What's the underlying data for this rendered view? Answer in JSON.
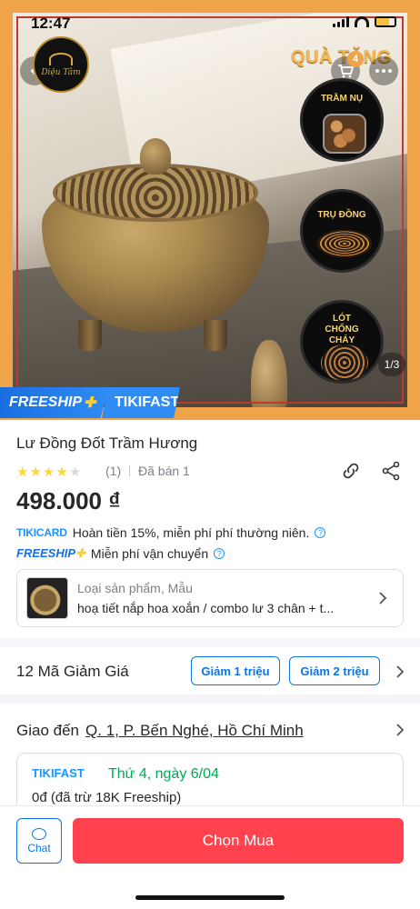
{
  "status": {
    "time": "12:47"
  },
  "hero": {
    "logo_text": "Diệu Tâm",
    "gift_title": "QUÀ TẶNG",
    "cart_count": "4",
    "gifts": [
      "TRẦM NỤ",
      "TRỤ ĐỒNG",
      "LÓT CHỐNG CHÁY"
    ],
    "image_counter": "1/3",
    "freeship_label": "FREESHIP",
    "tikifast_label": "TIKIFAST"
  },
  "product": {
    "title": "Lư Đồng Đốt Trầm Hương",
    "rating": 4,
    "rating_count": "(1)",
    "sold": "Đã bán 1",
    "price": "498.000 ₫"
  },
  "promos": [
    {
      "logo": "TIKICARD",
      "text": "Hoàn tiền 15%, miễn phí phí thường niên."
    },
    {
      "logo": "FREESHIP",
      "text": "Miễn phí vận chuyển"
    }
  ],
  "variant": {
    "label": "Loại sản phẩm, Mẫu",
    "value": "hoạ tiết nắp hoa xoắn / combo lư 3 chân + t..."
  },
  "coupons": {
    "title": "12 Mã Giảm Giá",
    "tags": [
      "Giảm 1 triệu",
      "Giảm 2 triệu"
    ]
  },
  "delivery": {
    "prefix": "Giao đến",
    "address": "Q. 1, P. Bến Nghé, Hồ Chí Minh",
    "service": "TIKIFAST",
    "date": "Thứ 4, ngày 6/04",
    "fee": "0đ (đã trừ 18K Freeship)"
  },
  "bottom": {
    "chat_label": "Chat",
    "buy_label": "Chọn Mua"
  },
  "colors": {
    "accent_blue": "#0b74e5",
    "buy_red": "#ff424e",
    "frame_orange": "#f0a44a",
    "delivery_green": "#00ab56"
  }
}
